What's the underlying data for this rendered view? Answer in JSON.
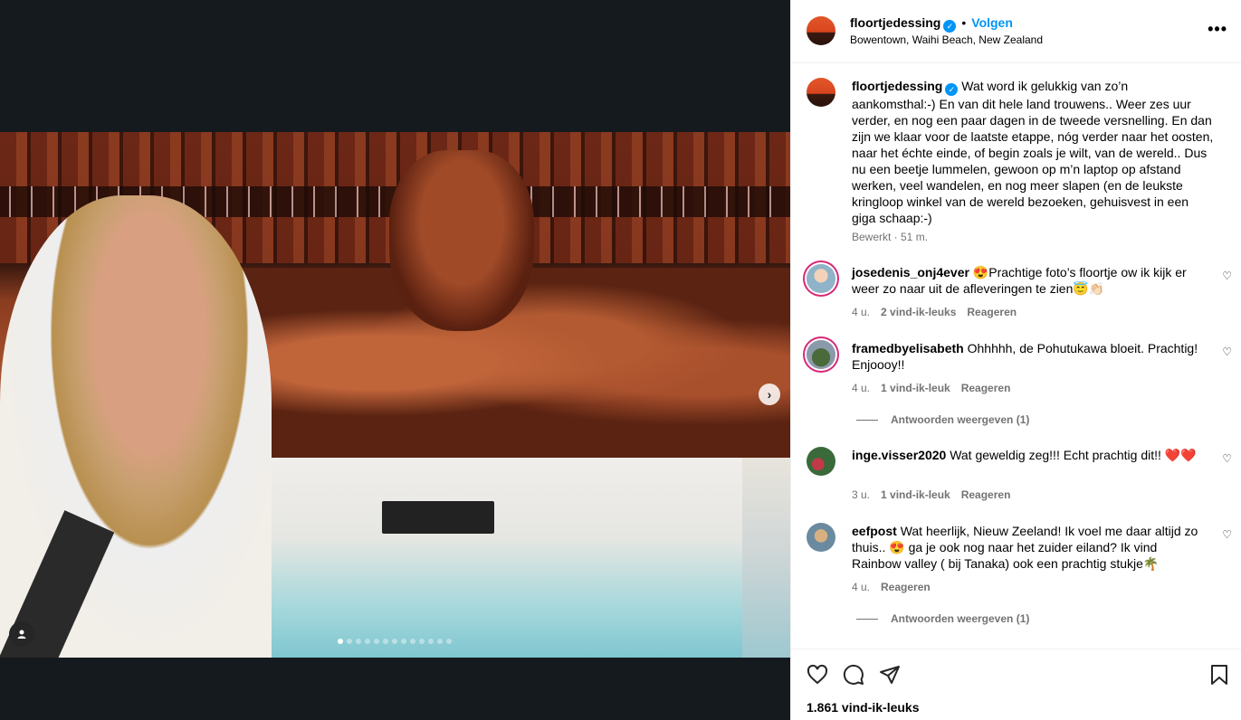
{
  "post": {
    "username": "floortjedessing",
    "follow_label": "Volgen",
    "separator": "•",
    "location": "Bowentown, Waihi Beach, New Zealand",
    "more_label": "•••",
    "caption": "Wat word ik gelukkig van zo’n aankomsthal:-) En van dit hele land trouwens.. Weer zes uur verder, en nog een paar dagen in de tweede versnelling. En dan zijn we klaar voor de laatste etappe, nóg verder naar het oosten, naar het échte einde, of begin zoals je wilt, van de wereld.. Dus nu een beetje lummelen, gewoon op m’n laptop op afstand werken, veel wandelen, en nog meer slapen (en de leukste kringloop winkel van de wereld bezoeken, gehuisvest in een giga schaap:-)",
    "caption_meta": "Bewerkt · 51 m.",
    "likes": "1.861 vind-ik-leuks",
    "carousel_count": 13,
    "carousel_active": 0
  },
  "comments": [
    {
      "username": "josedenis_onj4ever",
      "text": "😍Prachtige foto’s floortje ow ik kijk er weer zo naar uit de afleveringen te zien😇👏🏻",
      "time": "4 u.",
      "likes": "2 vind-ik-leuks",
      "reply": "Reageren"
    },
    {
      "username": "framedbyelisabeth",
      "text": "Ohhhhh, de Pohutukawa bloeit. Prachtig! Enjoooy!!",
      "time": "4 u.",
      "likes": "1 vind-ik-leuk",
      "reply": "Reageren",
      "view_replies": "Antwoorden weergeven (1)"
    },
    {
      "username": "inge.visser2020",
      "text": "Wat geweldig zeg!!! Echt prachtig dit!! ❤️❤️",
      "time": "3 u.",
      "likes": "1 vind-ik-leuk",
      "reply": "Reageren"
    },
    {
      "username": "eefpost",
      "text": "Wat heerlijk, Nieuw Zeeland! Ik voel me daar altijd zo thuis.. 😍 ga je ook nog naar het zuider eiland? Ik vind Rainbow valley ( bij Tanaka) ook een prachtig stukje🌴",
      "time": "4 u.",
      "reply": "Reageren",
      "view_replies": "Antwoorden weergeven (1)"
    }
  ],
  "icons": {
    "like": "heart-icon",
    "comment": "comment-icon",
    "share": "send-icon",
    "save": "bookmark-icon",
    "next": "chevron-right-icon",
    "user_tag": "user-tag-icon",
    "verified": "verified-badge-icon"
  }
}
